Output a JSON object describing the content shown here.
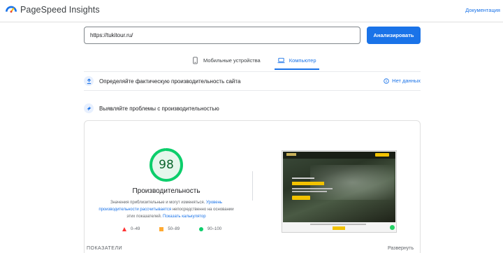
{
  "header": {
    "brand": "PageSpeed Insights",
    "docs_link": "Документация",
    "logo_color": "#1a73e8"
  },
  "search": {
    "value": "https://tukitour.ru/",
    "button_label": "Анализировать"
  },
  "tabs": [
    {
      "label": "Мобильные устройства",
      "icon": "smartphone-icon",
      "active": false
    },
    {
      "label": "Компьютер",
      "icon": "laptop-icon",
      "active": true
    }
  ],
  "field_data": {
    "title": "Определяйте фактическую производительность сайта",
    "status": "Нет данных"
  },
  "diagnostics": {
    "title": "Выявляйте проблемы с производительностью"
  },
  "score": {
    "value": "98",
    "fraction": 0.98,
    "label": "Производительность",
    "note_prefix": "Значения приблизительные и могут изменяться. ",
    "note_link": "Уровень производительности рассчитывается",
    "note_middle": " непосредственно на основании этих показателей. ",
    "note_calc_link": "Показать калькулятор",
    "color": "#0cce6b"
  },
  "legend": [
    {
      "range": "0–49",
      "shape": "triangle",
      "color": "#ff3333"
    },
    {
      "range": "50–89",
      "shape": "square",
      "color": "#ffaa33"
    },
    {
      "range": "90–100",
      "shape": "circle",
      "color": "#0cce6b"
    }
  ],
  "footer": {
    "metrics_label": "ПОКАЗАТЕЛИ",
    "expand_label": "Развернуть"
  }
}
